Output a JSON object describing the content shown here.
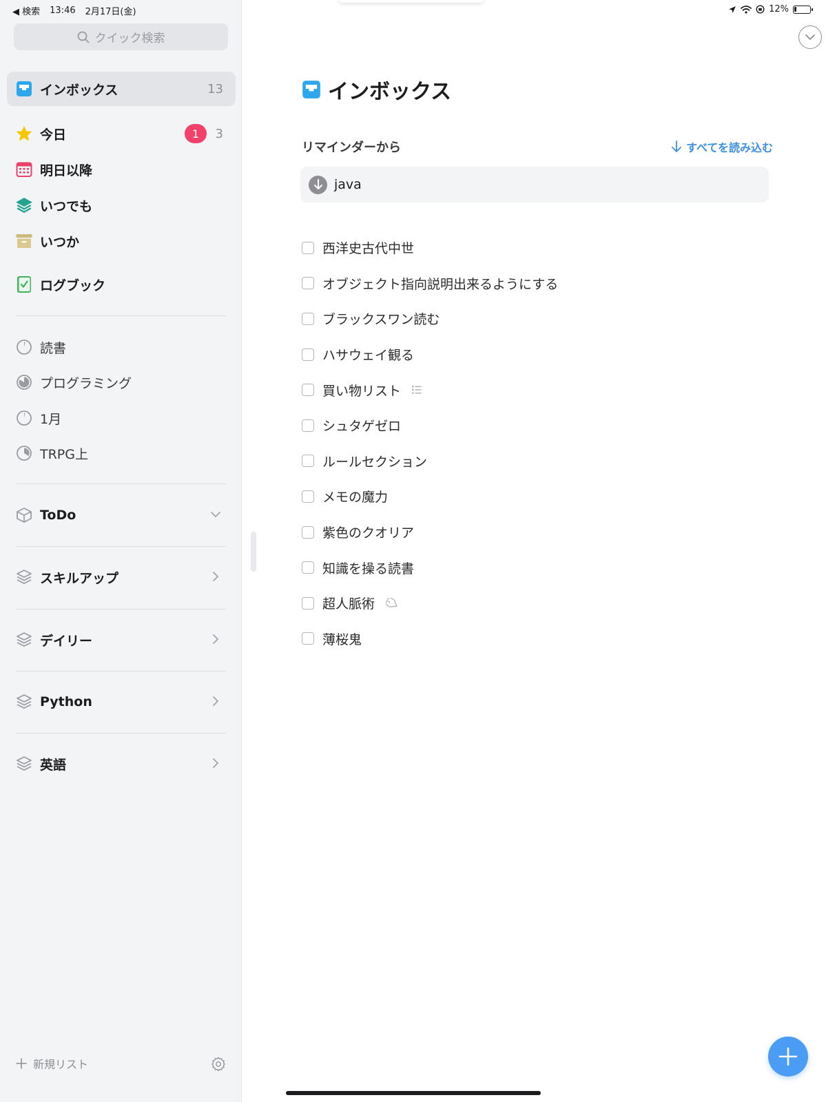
{
  "status_bar": {
    "back_label": "◀ 検索",
    "time": "13:46",
    "date": "2月17日(金)",
    "battery": "12%"
  },
  "sidebar": {
    "search_placeholder": "クイック検索",
    "nav": [
      {
        "label": "インボックス",
        "count": "13",
        "icon": "inbox-icon"
      },
      {
        "label": "今日",
        "badge": "1",
        "count": "3",
        "icon": "star-icon"
      },
      {
        "label": "明日以降",
        "icon": "calendar-icon"
      },
      {
        "label": "いつでも",
        "icon": "layers-icon"
      },
      {
        "label": "いつか",
        "icon": "archive-box-icon"
      },
      {
        "label": "ログブック",
        "icon": "logbook-icon"
      }
    ],
    "projects": [
      {
        "label": "読書"
      },
      {
        "label": "プログラミング"
      },
      {
        "label": "1月"
      },
      {
        "label": "TRPG上"
      }
    ],
    "areas": [
      {
        "label": "ToDo",
        "expanded": true
      },
      {
        "label": "スキルアップ"
      },
      {
        "label": "デイリー"
      },
      {
        "label": "Python"
      },
      {
        "label": "英語"
      }
    ],
    "footer": {
      "new_list": "新規リスト"
    }
  },
  "main": {
    "title": "インボックス",
    "section_title": "リマインダーから",
    "import_all": "すべてを読み込む",
    "reminder": "java",
    "tasks": [
      "西洋史古代中世",
      "オブジェクト指向説明出来るようにする",
      "ブラックスワン読む",
      "ハサウェイ観る",
      "買い物リスト",
      "シュタゲゼロ",
      "ルールセクション",
      "メモの魔力",
      "紫色のクオリア",
      "知識を操る読書",
      "超人脈術",
      "薄桜鬼"
    ]
  },
  "colors": {
    "accent": "#3d8fe0",
    "badge": "#f2416b",
    "inbox": "#2ea8ec",
    "star": "#f7c600",
    "calendar": "#ec3f6a",
    "anytime": "#24a38f",
    "someday": "#cdbb7c",
    "logbook": "#3fb45b",
    "fab": "#4b9cf5"
  }
}
